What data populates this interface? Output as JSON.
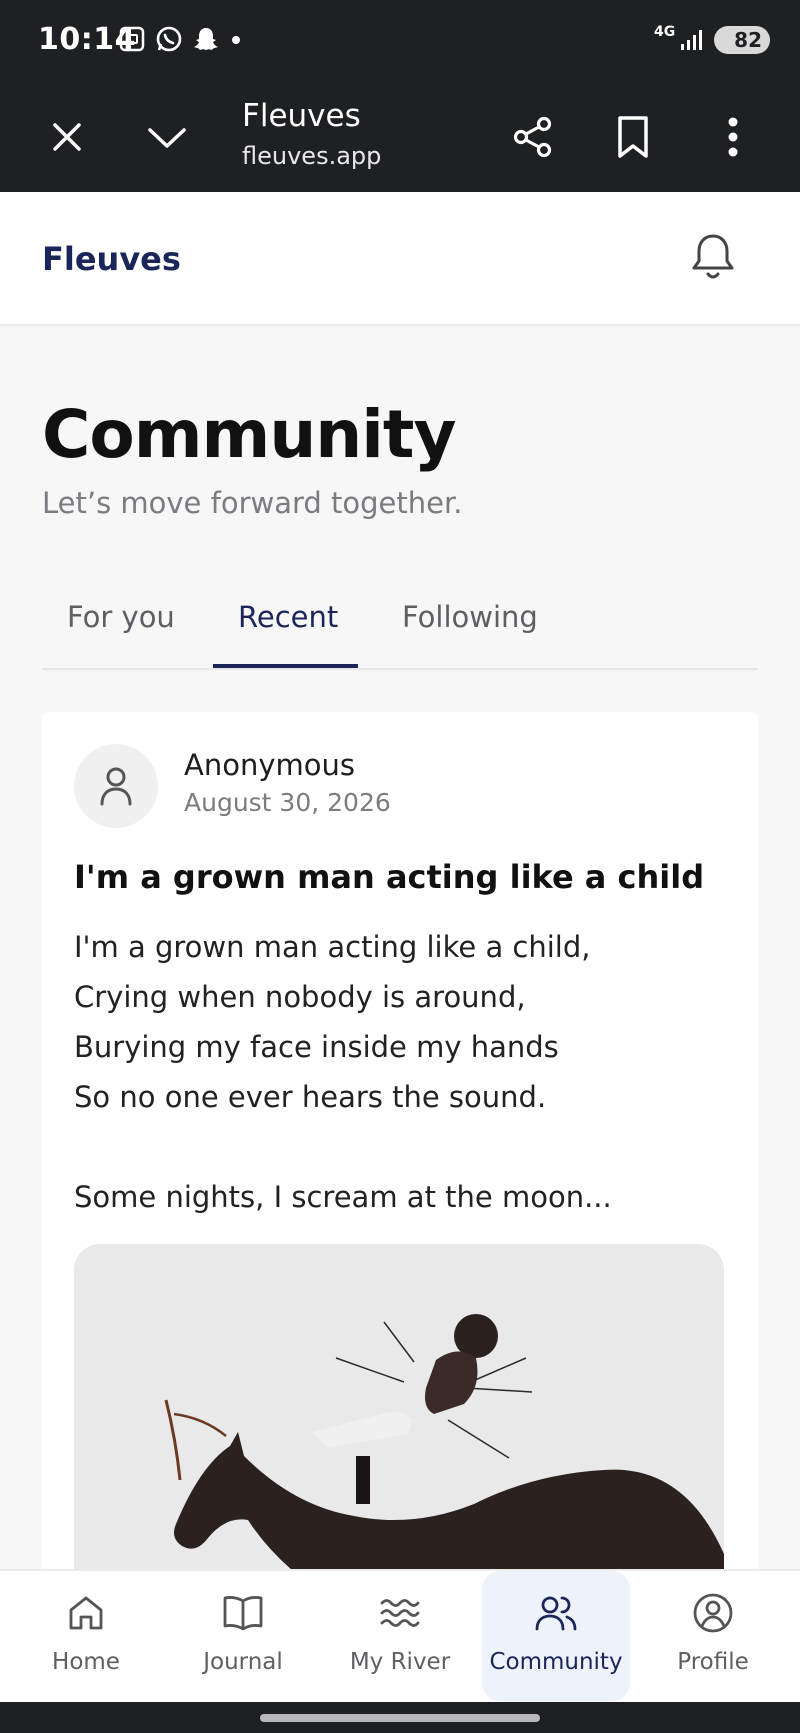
{
  "status_bar": {
    "time": "10:14",
    "network": "4G",
    "battery": "82",
    "icons": [
      "screenshot-icon",
      "whatsapp-icon",
      "snapchat-icon",
      "dot-icon",
      "signal-icon",
      "battery-icon"
    ]
  },
  "browser_bar": {
    "title": "Fleuves",
    "url": "fleuves.app",
    "icons": [
      "close-icon",
      "chevron-down-icon",
      "share-icon",
      "bookmark-icon",
      "more-vertical-icon"
    ]
  },
  "app_header": {
    "brand": "Fleuves",
    "icon": "bell-icon"
  },
  "page": {
    "title": "Community",
    "subtitle": "Let’s move forward together."
  },
  "tabs": [
    {
      "label": "For you",
      "active": false
    },
    {
      "label": "Recent",
      "active": true
    },
    {
      "label": "Following",
      "active": false
    }
  ],
  "post": {
    "author": "Anonymous",
    "date": "August 30, 2026",
    "title": "I'm a grown man acting like a child",
    "lines": [
      "I'm a grown man acting like a child,",
      "Crying when nobody is around,",
      "Burying my face inside my hands",
      "So no one ever hears the sound.",
      "",
      "Some nights, I scream at the moon..."
    ],
    "image": "horse-rider-silhouette-image"
  },
  "bottom_nav": [
    {
      "label": "Home",
      "icon": "home-icon",
      "active": false
    },
    {
      "label": "Journal",
      "icon": "book-icon",
      "active": false
    },
    {
      "label": "My River",
      "icon": "waves-icon",
      "active": false
    },
    {
      "label": "Community",
      "icon": "users-icon",
      "active": true
    },
    {
      "label": "Profile",
      "icon": "profile-icon",
      "active": false
    }
  ],
  "colors": {
    "brand": "#1b2559",
    "system_bar": "#1f2023",
    "active_nav_bg": "#eef3fb"
  }
}
